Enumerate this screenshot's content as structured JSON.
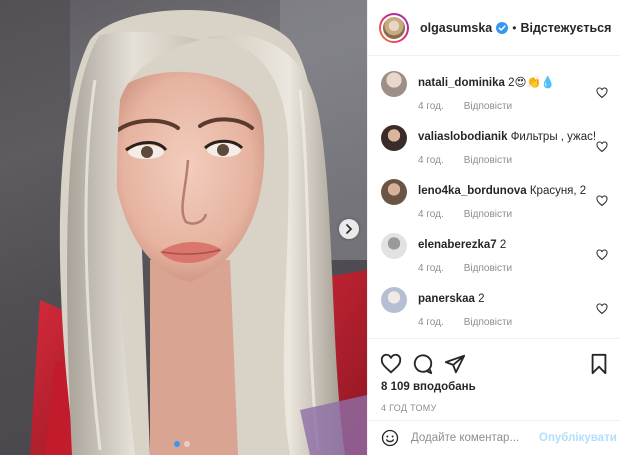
{
  "post": {
    "image_alt_icon": "post-photo",
    "carousel_dots": 2,
    "active_dot": 1
  },
  "header": {
    "username": "olgasumska",
    "separator": "•",
    "follow_label": "Відстежується"
  },
  "comments": [
    {
      "user": "natali_dominika",
      "text": "2😍👏💧",
      "time": "4 год.",
      "reply": "Відповісти",
      "avatar_color": "#b9b6b3"
    },
    {
      "user": "valiaslobodianik",
      "text": "Фильтры , ужас!",
      "time": "4 год.",
      "reply": "Відповісти",
      "avatar_color": "#6b5a4f"
    },
    {
      "user": "leno4ka_bordunova",
      "text": "Красуня, 2",
      "time": "4 год.",
      "reply": "Відповісти",
      "avatar_color": "#7d6a5b"
    },
    {
      "user": "elenaberezka7",
      "text": "2",
      "time": "4 год.",
      "reply": "Відповісти",
      "avatar_color": "#cfcfcf"
    },
    {
      "user": "panerskaa",
      "text": "2",
      "time": "4 год.",
      "reply": "Відповісти",
      "avatar_color": "#c7cfe0"
    }
  ],
  "likes": "8 109 вподобань",
  "timestamp": "4 ГОД ТОМУ",
  "comment_box": {
    "placeholder": "Додайте коментар...",
    "publish_label": "Опублікувати"
  },
  "colors": {
    "accent": "#3897f0",
    "publish_disabled": "#b2dffc",
    "muted": "#8e8e8e"
  }
}
